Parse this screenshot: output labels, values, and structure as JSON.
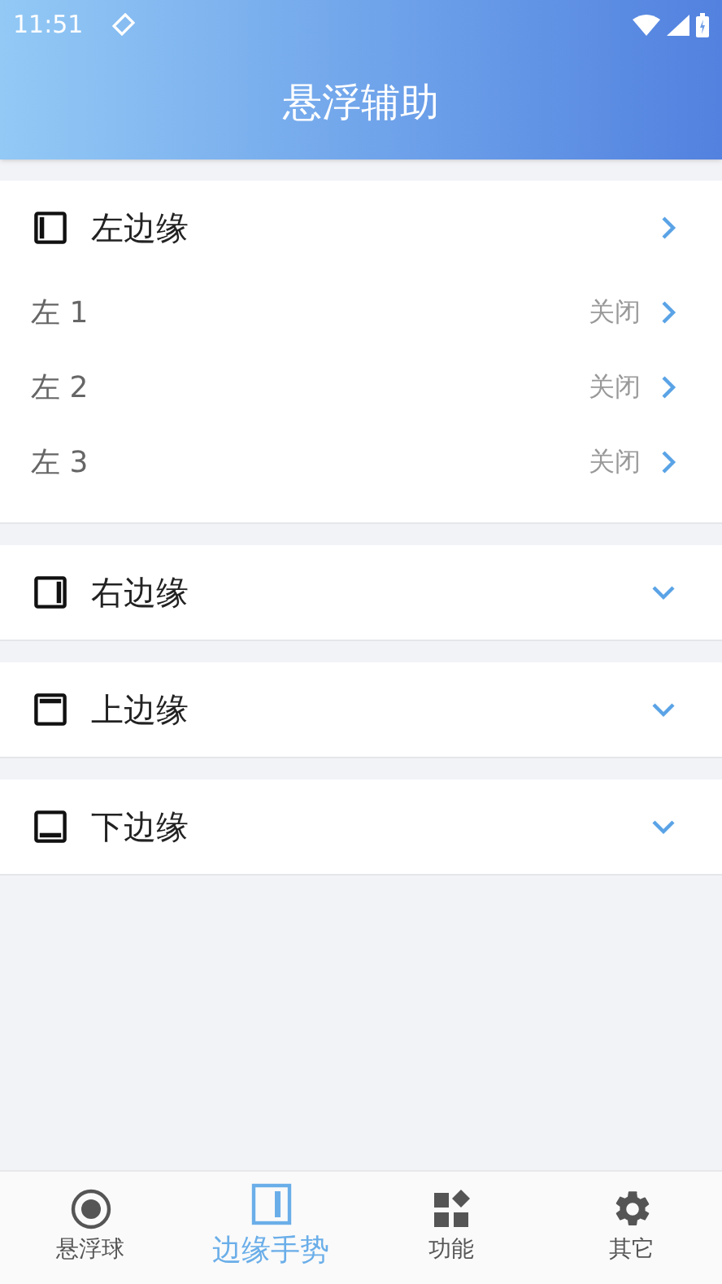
{
  "status_bar": {
    "time": "11:51"
  },
  "title": "悬浮辅助",
  "sections": [
    {
      "kind": "left",
      "title": "左边缘",
      "expanded": true,
      "items": [
        {
          "label": "左 1",
          "value": "关闭"
        },
        {
          "label": "左 2",
          "value": "关闭"
        },
        {
          "label": "左 3",
          "value": "关闭"
        }
      ]
    },
    {
      "kind": "right",
      "title": "右边缘",
      "expanded": false
    },
    {
      "kind": "top",
      "title": "上边缘",
      "expanded": false
    },
    {
      "kind": "bottom",
      "title": "下边缘",
      "expanded": false
    }
  ],
  "nav": [
    {
      "kind": "ball",
      "label": "悬浮球",
      "selected": false
    },
    {
      "kind": "edge",
      "label": "边缘手势",
      "selected": true
    },
    {
      "kind": "apps",
      "label": "功能",
      "selected": false
    },
    {
      "kind": "gear",
      "label": "其它",
      "selected": false
    }
  ]
}
